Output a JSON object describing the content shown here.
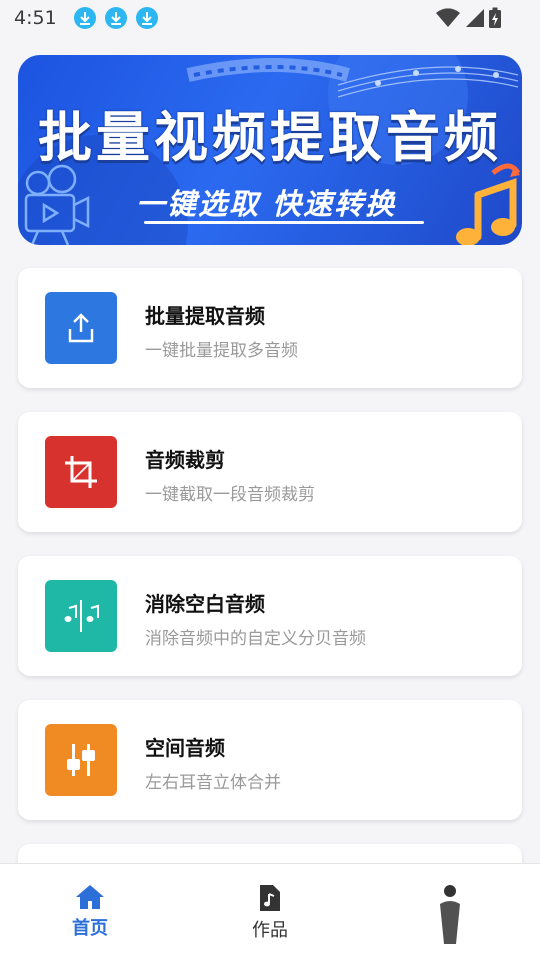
{
  "status_bar": {
    "time": "4:51"
  },
  "banner": {
    "title": "批量视频提取音频",
    "subtitle": "一键选取 快速转换"
  },
  "features": [
    {
      "title": "批量提取音频",
      "subtitle": "一键批量提取多音频",
      "icon": "upload-icon",
      "color": "#2d78e0"
    },
    {
      "title": "音频裁剪",
      "subtitle": "一键截取一段音频裁剪",
      "icon": "crop-icon",
      "color": "#d8322f"
    },
    {
      "title": "消除空白音频",
      "subtitle": "消除音频中的自定义分贝音频",
      "icon": "music-split-icon",
      "color": "#1fb8a6"
    },
    {
      "title": "空间音频",
      "subtitle": "左右耳音立体合并",
      "icon": "sliders-icon",
      "color": "#f08a22"
    }
  ],
  "nav": {
    "home": "首页",
    "works": "作品",
    "active_color": "#2d6fd8"
  }
}
